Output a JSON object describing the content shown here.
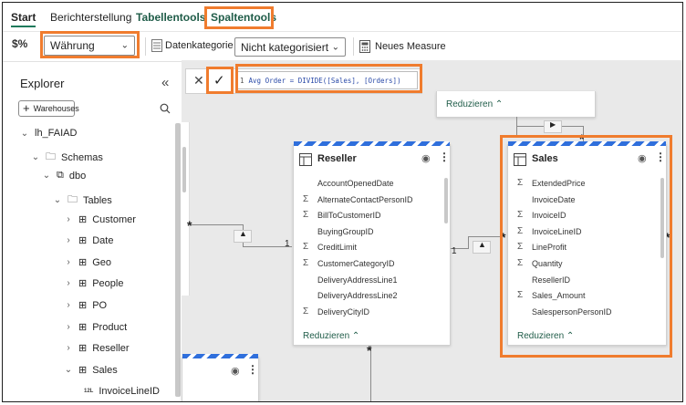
{
  "ribbon": {
    "tabs": [
      {
        "label": "Start"
      },
      {
        "label": "Berichterstellung"
      },
      {
        "label": "Tabellentools"
      },
      {
        "label": "Spaltentools"
      }
    ]
  },
  "toolbar": {
    "format_value": "Währung",
    "data_category_label": "Datenkategorie",
    "data_category_value": "Nicht kategorisiert",
    "new_measure_label": "Neues Measure"
  },
  "formula": {
    "line_number": "1",
    "expression": "Avg Order = DIVIDE([Sales], [Orders])"
  },
  "explorer": {
    "title": "Explorer",
    "warehouses_button": "Warehouses",
    "tree": {
      "root": "lh_FAIAD",
      "schemas": "Schemas",
      "dbo": "dbo",
      "tables": "Tables",
      "tables_list": [
        "Customer",
        "Date",
        "Geo",
        "People",
        "PO",
        "Product",
        "Reseller",
        "Sales"
      ],
      "sales_child": "InvoiceLineID",
      "sales_child_type": "12L"
    }
  },
  "canvas": {
    "top_card_reduce": "Reduzieren",
    "reseller": {
      "title": "Reseller",
      "fields": [
        {
          "name": "AccountOpenedDate",
          "sum": false
        },
        {
          "name": "AlternateContactPersonID",
          "sum": true
        },
        {
          "name": "BillToCustomerID",
          "sum": true
        },
        {
          "name": "BuyingGroupID",
          "sum": false
        },
        {
          "name": "CreditLimit",
          "sum": true
        },
        {
          "name": "CustomerCategoryID",
          "sum": true
        },
        {
          "name": "DeliveryAddressLine1",
          "sum": false
        },
        {
          "name": "DeliveryAddressLine2",
          "sum": false
        },
        {
          "name": "DeliveryCityID",
          "sum": true
        }
      ],
      "reduce": "Reduzieren"
    },
    "sales": {
      "title": "Sales",
      "fields": [
        {
          "name": "ExtendedPrice",
          "sum": true
        },
        {
          "name": "InvoiceDate",
          "sum": false
        },
        {
          "name": "InvoiceID",
          "sum": true
        },
        {
          "name": "InvoiceLineID",
          "sum": true
        },
        {
          "name": "LineProfit",
          "sum": true
        },
        {
          "name": "Quantity",
          "sum": true
        },
        {
          "name": "ResellerID",
          "sum": false
        },
        {
          "name": "Sales_Amount",
          "sum": true
        },
        {
          "name": "SalespersonPersonID",
          "sum": false
        }
      ],
      "reduce": "Reduzieren"
    },
    "cardinality": {
      "many": "*",
      "one": "1"
    }
  },
  "colors": {
    "highlight": "#f07c2e",
    "accent": "#1f7a5c",
    "card_stripe": "#2f6fdc"
  }
}
